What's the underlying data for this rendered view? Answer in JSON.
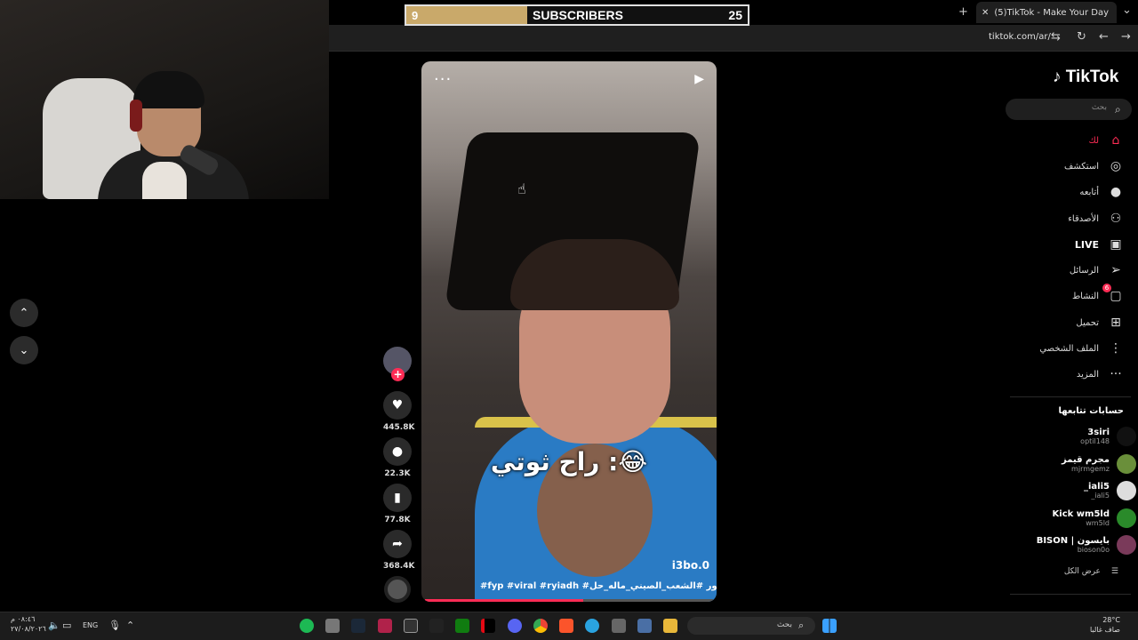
{
  "overlay": {
    "subscribers_current": "9",
    "subscribers_label": "SUBSCRIBERS",
    "subscribers_goal": "25",
    "subscribers_progress": 0.36
  },
  "browser": {
    "tab_title": "(5)TikTok - Make Your Day",
    "url": "tiktok.com/ar/"
  },
  "video": {
    "caption": "راح ثوتي :😂",
    "username": "i3bo.0",
    "hashtags": "#fyp #viral #ryiadh #اكسبلور #الشعب_الصيني_ماله_حل 😂😂",
    "progress": 0.55,
    "likes": "445.8K",
    "comments": "22.3K",
    "saves": "77.8K",
    "shares": "368.4K"
  },
  "sidebar": {
    "logo": "TikTok",
    "search_placeholder": "بحث",
    "nav": [
      {
        "label": "لك",
        "icon": "home-icon"
      },
      {
        "label": "استكشف",
        "icon": "compass-icon"
      },
      {
        "label": "أتابعه",
        "icon": "following-icon"
      },
      {
        "label": "الأصدقاء",
        "icon": "friends-icon"
      },
      {
        "label": "LIVE",
        "icon": "live-icon"
      },
      {
        "label": "الرسائل",
        "icon": "messages-icon"
      },
      {
        "label": "النشاط",
        "icon": "activity-icon"
      },
      {
        "label": "تحميل",
        "icon": "upload-icon"
      },
      {
        "label": "الملف الشخصي",
        "icon": "profile-icon"
      },
      {
        "label": "المزيد",
        "icon": "more-icon"
      }
    ],
    "following_title": "حسابات تتابعها",
    "accounts": [
      {
        "name": "3siri",
        "handle": "optil148",
        "color": "#111"
      },
      {
        "name": "مجرم قيمز",
        "handle": "mjrmgemz",
        "color": "#6a8f3a"
      },
      {
        "name": "_iali5",
        "handle": "_iali5",
        "color": "#ddd"
      },
      {
        "name": "Kick wm5ld",
        "handle": "wm5ld",
        "color": "#2a8a2a"
      },
      {
        "name": "BISON | بايسون",
        "handle": "bioson0o",
        "color": "#7a3a5a"
      }
    ],
    "see_all": "عرض الكل",
    "activity_badge": "6"
  },
  "taskbar": {
    "search_placeholder": "بحث",
    "language": "ENG",
    "time": "٠٨:٤٦ م",
    "date": "٢٧/٠٨/٢٠٢٦",
    "weather_temp": "28°C",
    "weather_desc": "صاف غالبا"
  }
}
